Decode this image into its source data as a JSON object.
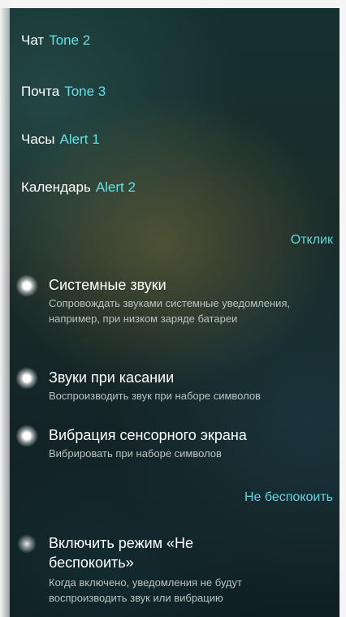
{
  "tones": [
    {
      "label": "Чат",
      "value": "Tone 2"
    },
    {
      "label": "Почта",
      "value": "Tone 3"
    },
    {
      "label": "Часы",
      "value": "Alert 1"
    },
    {
      "label": "Календарь",
      "value": "Alert 2"
    }
  ],
  "sections": {
    "feedback": "Отклик",
    "dnd": "Не беспокоить"
  },
  "feedback_items": [
    {
      "title": "Системные звуки",
      "desc": "Сопровождать звуками системные уведомления, например, при низком заряде батареи"
    },
    {
      "title": "Звуки при касании",
      "desc": "Воспроизводить звук при наборе символов"
    },
    {
      "title": "Вибрация сенсорного экрана",
      "desc": "Вибрировать при наборе символов"
    }
  ],
  "dnd_item": {
    "title": "Включить режим «Не беспокоить»",
    "desc": "Когда включено, уведомления не будут воспроизводить звук или вибрацию"
  },
  "colors": {
    "accent": "#5fd9df",
    "text": "#ffffff",
    "secondary": "#b9c3c2"
  }
}
